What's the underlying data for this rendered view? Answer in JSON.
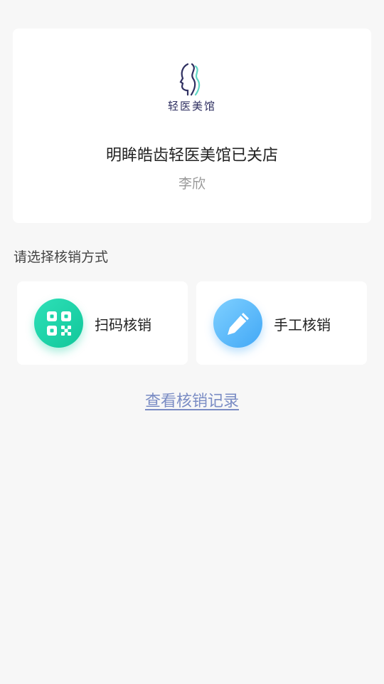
{
  "store": {
    "logo_text": "轻医美馆",
    "status_text": "明眸皓齿轻医美馆已关店",
    "operator_name": "李欣"
  },
  "section": {
    "title": "请选择核销方式"
  },
  "methods": [
    {
      "label": "扫码核销",
      "icon": "qr-code-icon",
      "color": "#1bd3a8"
    },
    {
      "label": "手工核销",
      "icon": "pencil-icon",
      "color": "#5bb8fa"
    }
  ],
  "links": {
    "view_records": "查看核销记录"
  },
  "colors": {
    "background": "#f7f7f7",
    "link": "#7a8cc4",
    "logo": "#2f3061",
    "logo_accent": "#5fd8c5"
  }
}
